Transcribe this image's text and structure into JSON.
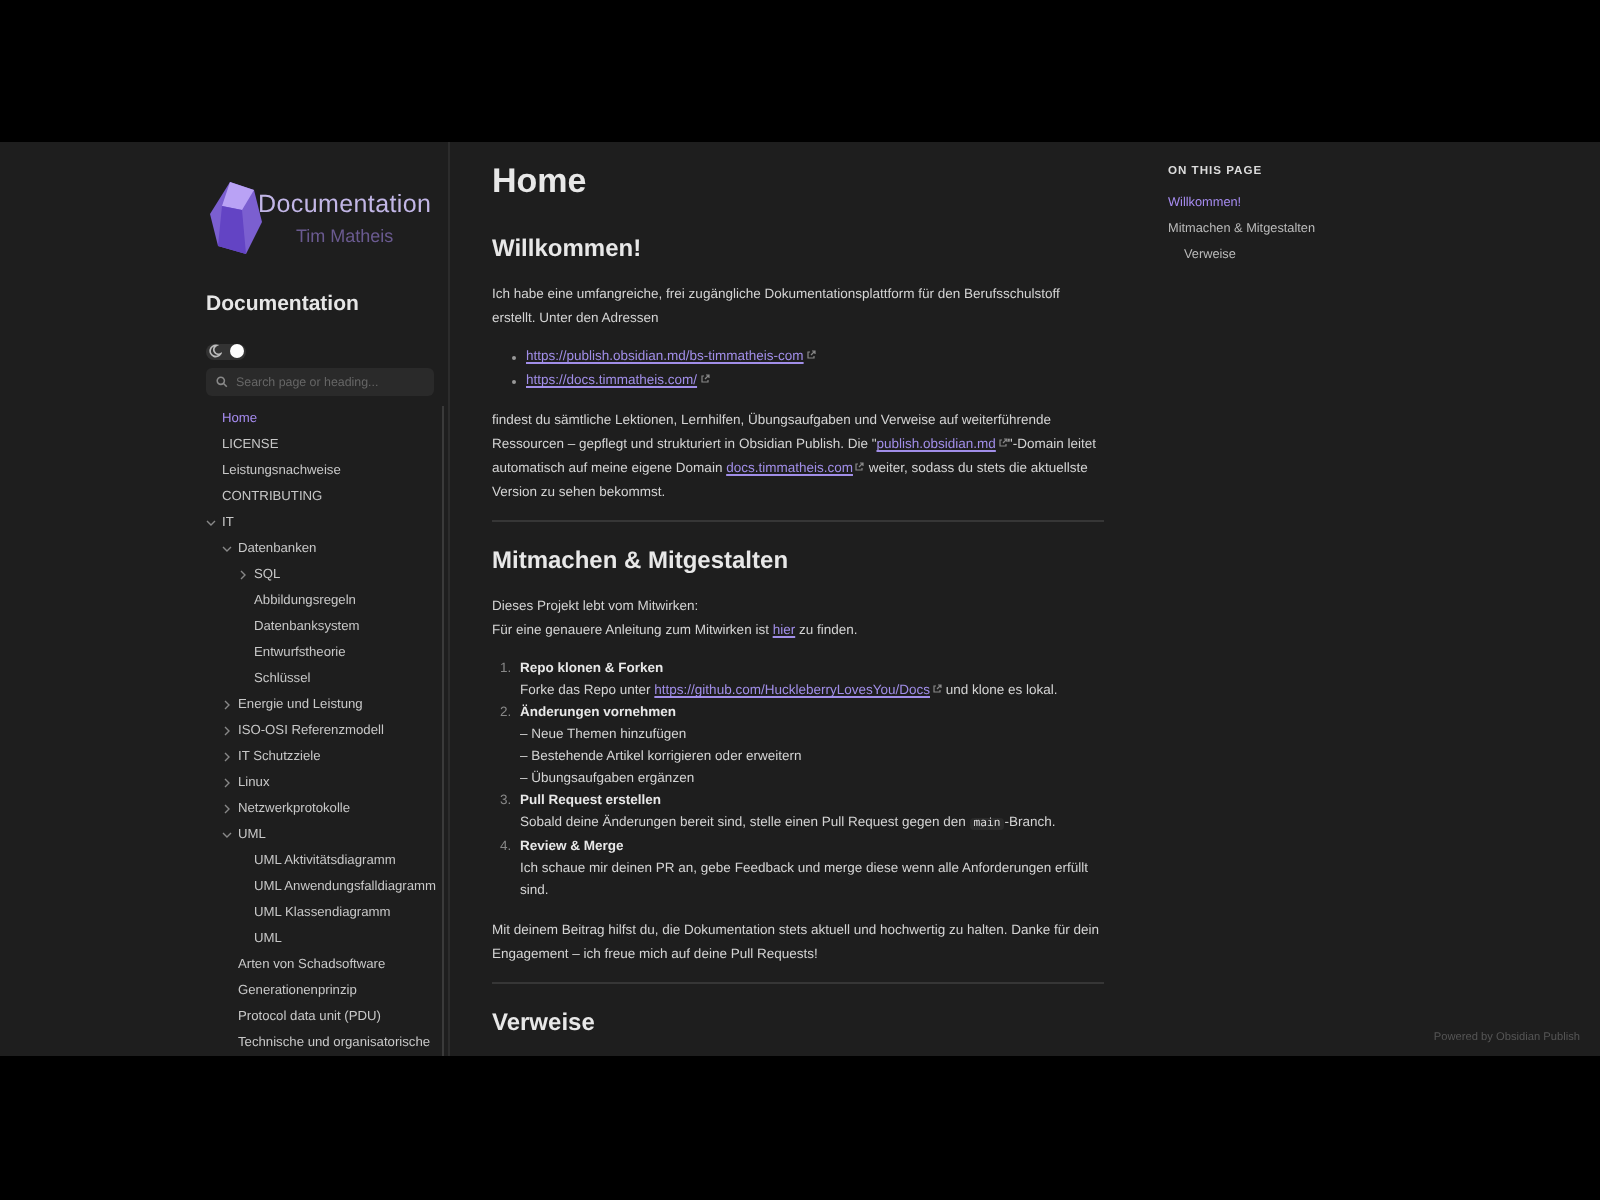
{
  "logo": {
    "title": "Documentation",
    "subtitle": "Tim Matheis"
  },
  "site_title": "Documentation",
  "theme_toggle": {
    "on": true
  },
  "search": {
    "placeholder": "Search page or heading..."
  },
  "nav": [
    {
      "label": "Home",
      "selected": true
    },
    {
      "label": "LICENSE",
      "selected": false
    },
    {
      "label": "Leistungsnachweise",
      "selected": false
    },
    {
      "label": "CONTRIBUTING",
      "selected": false
    },
    {
      "label": "IT",
      "selected": false,
      "expanded": true,
      "children": [
        {
          "label": "Datenbanken",
          "selected": false,
          "expanded": true,
          "children": [
            {
              "label": "SQL",
              "selected": false,
              "expanded": false
            },
            {
              "label": "Abbildungsregeln",
              "selected": false
            },
            {
              "label": "Datenbanksystem",
              "selected": false
            },
            {
              "label": "Entwurfstheorie",
              "selected": false
            },
            {
              "label": "Schlüssel",
              "selected": false
            }
          ]
        },
        {
          "label": "Energie und Leistung",
          "selected": false,
          "expanded": false
        },
        {
          "label": "ISO-OSI Referenzmodell",
          "selected": false,
          "expanded": false
        },
        {
          "label": "IT Schutzziele",
          "selected": false,
          "expanded": false
        },
        {
          "label": "Linux",
          "selected": false,
          "expanded": false
        },
        {
          "label": "Netzwerkprotokolle",
          "selected": false,
          "expanded": false
        },
        {
          "label": "UML",
          "selected": false,
          "expanded": true,
          "children": [
            {
              "label": "UML Aktivitätsdiagramm",
              "selected": false
            },
            {
              "label": "UML Anwendungsfalldiagramm",
              "selected": false
            },
            {
              "label": "UML Klassendiagramm",
              "selected": false
            },
            {
              "label": "UML",
              "selected": false
            }
          ]
        },
        {
          "label": "Arten von Schadsoftware",
          "selected": false
        },
        {
          "label": "Generationenprinzip",
          "selected": false
        },
        {
          "label": "Protocol data unit (PDU)",
          "selected": false
        },
        {
          "label": "Technische und organisatorische",
          "selected": false
        }
      ]
    }
  ],
  "article": {
    "title": "Home",
    "sections": [
      {
        "heading": "Willkommen!",
        "blocks": [
          {
            "kind": "paragraph",
            "lines": [
              [
                {
                  "kind": "text",
                  "text": "Ich habe eine umfangreiche, frei zugängliche Dokumentationsplattform für den Berufsschulstoff erstellt. Unter den Adressen"
                }
              ]
            ]
          },
          {
            "kind": "bullets",
            "items": [
              [
                {
                  "kind": "link",
                  "text": "https://publish.obsidian.md/bs-timmatheis-com",
                  "external": true
                }
              ],
              [
                {
                  "kind": "link",
                  "text": "https://docs.timmatheis.com/",
                  "external": true
                }
              ]
            ]
          },
          {
            "kind": "paragraph",
            "lines": [
              [
                {
                  "kind": "text",
                  "text": "findest du sämtliche Lektionen, Lernhilfen, Übungsaufgaben und Verweise auf weiterführende Ressourcen – gepflegt und strukturiert in Obsidian Publish. Die \""
                },
                {
                  "kind": "link",
                  "text": "publish.obsidian.md",
                  "external": true
                },
                {
                  "kind": "text",
                  "text": "\"-Domain leitet automatisch auf meine eigene Domain "
                },
                {
                  "kind": "link",
                  "text": "docs.timmatheis.com",
                  "external": true
                },
                {
                  "kind": "text",
                  "text": " weiter, sodass du stets die aktuellste Version zu sehen bekommst."
                }
              ]
            ]
          },
          {
            "kind": "rule"
          }
        ]
      },
      {
        "heading": "Mitmachen & Mitgestalten",
        "blocks": [
          {
            "kind": "paragraph",
            "lines": [
              [
                {
                  "kind": "text",
                  "text": "Dieses Projekt lebt vom Mitwirken:"
                }
              ],
              [
                {
                  "kind": "text",
                  "text": "Für eine genauere Anleitung zum Mitwirken ist "
                },
                {
                  "kind": "link",
                  "text": "hier",
                  "external": false
                },
                {
                  "kind": "text",
                  "text": " zu finden."
                }
              ]
            ]
          },
          {
            "kind": "steps",
            "items": [
              {
                "number": "1.",
                "title": "Repo klonen & Forken",
                "lines": [
                  [
                    {
                      "kind": "text",
                      "text": "Forke das Repo unter "
                    },
                    {
                      "kind": "link",
                      "text": "https://github.com/HuckleberryLovesYou/Docs",
                      "external": true
                    },
                    {
                      "kind": "text",
                      "text": " und klone es lokal."
                    }
                  ]
                ]
              },
              {
                "number": "2.",
                "title": "Änderungen vornehmen",
                "lines": [
                  [
                    {
                      "kind": "text",
                      "text": "– Neue Themen hinzufügen"
                    }
                  ],
                  [
                    {
                      "kind": "text",
                      "text": "– Bestehende Artikel korrigieren oder erweitern"
                    }
                  ],
                  [
                    {
                      "kind": "text",
                      "text": "– Übungsaufgaben ergänzen"
                    }
                  ]
                ]
              },
              {
                "number": "3.",
                "title": "Pull Request erstellen",
                "lines": [
                  [
                    {
                      "kind": "text",
                      "text": "Sobald deine Änderungen bereit sind, stelle einen Pull Request gegen den "
                    },
                    {
                      "kind": "code",
                      "text": "main"
                    },
                    {
                      "kind": "text",
                      "text": "-Branch."
                    }
                  ]
                ]
              },
              {
                "number": "4.",
                "title": "Review & Merge",
                "lines": [
                  [
                    {
                      "kind": "text",
                      "text": "Ich schaue mir deinen PR an, gebe Feedback und merge diese wenn alle Anforderungen erfüllt sind."
                    }
                  ]
                ]
              }
            ]
          },
          {
            "kind": "paragraph",
            "lines": [
              [
                {
                  "kind": "text",
                  "text": "Mit deinem Beitrag hilfst du, die Dokumentation stets aktuell und hochwertig zu halten. Danke für dein Engagement – ich freue mich auf deine Pull Requests!"
                }
              ]
            ]
          },
          {
            "kind": "rule"
          }
        ]
      },
      {
        "heading": "Verweise"
      }
    ]
  },
  "toc": {
    "heading": "ON THIS PAGE",
    "items": [
      {
        "label": "Willkommen!",
        "selected": true
      },
      {
        "label": "Mitmachen & Mitgestalten",
        "selected": false,
        "children": [
          {
            "label": "Verweise",
            "selected": false
          }
        ]
      }
    ]
  },
  "footer": "Powered by Obsidian Publish"
}
